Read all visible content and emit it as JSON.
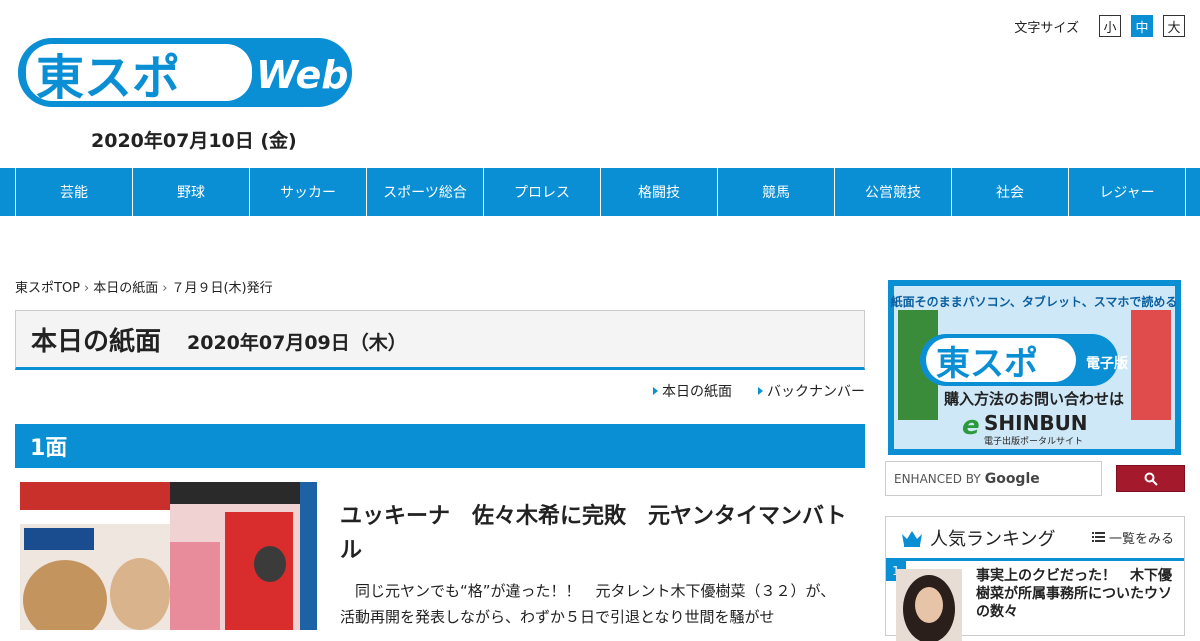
{
  "header": {
    "logo_text": "東スポ",
    "logo_web": "Web",
    "date": "2020年07月10日 (金)",
    "fontsize_label": "文字サイズ",
    "fontsize_options": [
      "小",
      "中",
      "大"
    ],
    "fontsize_active": "中"
  },
  "nav": [
    "芸能",
    "野球",
    "サッカー",
    "スポーツ総合",
    "プロレス",
    "格闘技",
    "競馬",
    "公営競技",
    "社会",
    "レジャー"
  ],
  "breadcrumb": [
    "東スポTOP",
    "本日の紙面",
    "７月９日(木)発行"
  ],
  "title": {
    "main": "本日の紙面",
    "date": "2020年07月09日（木）"
  },
  "sublinks": [
    "本日の紙面",
    "バックナンバー"
  ],
  "section": "1面",
  "article": {
    "title": "ユッキーナ　佐々木希に完敗　元ヤンタイマンバトル",
    "body": "　同じ元ヤンでも“格”が違った！！　元タレント木下優樹菜（３２）が、活動再開を発表しながら、わずか５日で引退となり世間を騒がせ"
  },
  "ad": {
    "top": "紙面そのままパソコン、タブレット、スマホで読める",
    "brand": "東スポ",
    "edition": "電子版",
    "cta": "購入方法のお問い合わせは",
    "service": "SHINBUN",
    "service_prefix": "e",
    "service_sub": "電子出版ポータルサイト"
  },
  "search": {
    "enhanced_by": "ENHANCED BY",
    "google": "Google"
  },
  "ranking": {
    "title": "人気ランキング",
    "more": "一覧をみる",
    "items": [
      {
        "rank": "1",
        "title": "事実上のクビだった！　木下優樹菜が所属事務所についたウソの数々"
      }
    ]
  },
  "colors": {
    "brand_blue": "#0b8fd4",
    "search_button": "#a4192c"
  }
}
